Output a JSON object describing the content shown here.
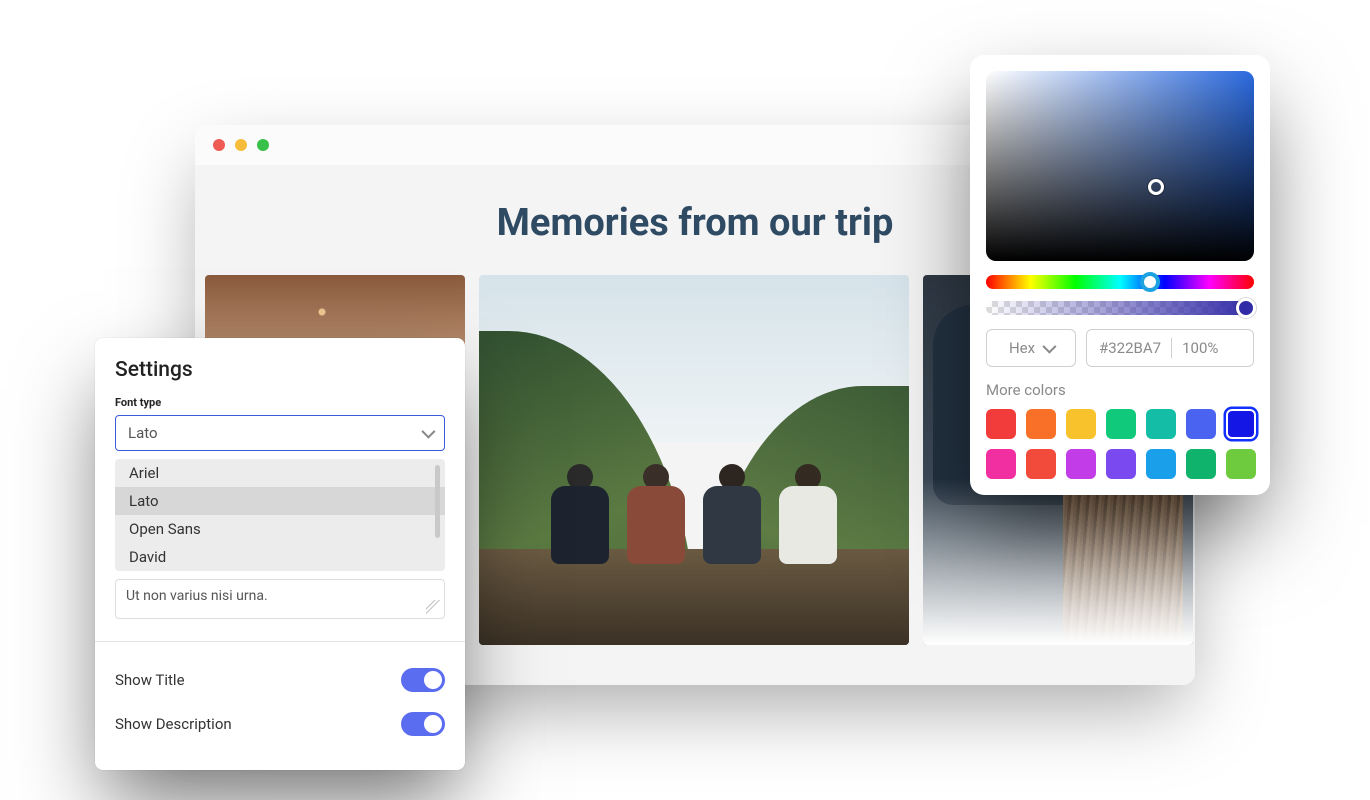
{
  "gallery": {
    "title": "Memories from our trip"
  },
  "settings": {
    "heading": "Settings",
    "font_type_label": "Font type",
    "font_selected": "Lato",
    "font_options": [
      "Ariel",
      "Lato",
      "Open Sans",
      "David"
    ],
    "description_value": "Ut non varius nisi urna.",
    "show_title_label": "Show Title",
    "show_title_on": true,
    "show_description_label": "Show Description",
    "show_description_on": true
  },
  "color_picker": {
    "format_label": "Hex",
    "hex_value": "#322BA7",
    "alpha_value": "100%",
    "more_colors_label": "More colors",
    "swatches": [
      {
        "color": "#f23b3b",
        "selected": false
      },
      {
        "color": "#f97028",
        "selected": false
      },
      {
        "color": "#f8c22d",
        "selected": false
      },
      {
        "color": "#10c97a",
        "selected": false
      },
      {
        "color": "#13bda6",
        "selected": false
      },
      {
        "color": "#4a63f0",
        "selected": false
      },
      {
        "color": "#1416e6",
        "selected": true
      },
      {
        "color": "#f22fa0",
        "selected": false
      },
      {
        "color": "#f24a3b",
        "selected": false
      },
      {
        "color": "#c23ce8",
        "selected": false
      },
      {
        "color": "#7a4af0",
        "selected": false
      },
      {
        "color": "#1aa0ea",
        "selected": false
      },
      {
        "color": "#0fb36b",
        "selected": false
      },
      {
        "color": "#6ecb3e",
        "selected": false
      }
    ]
  }
}
